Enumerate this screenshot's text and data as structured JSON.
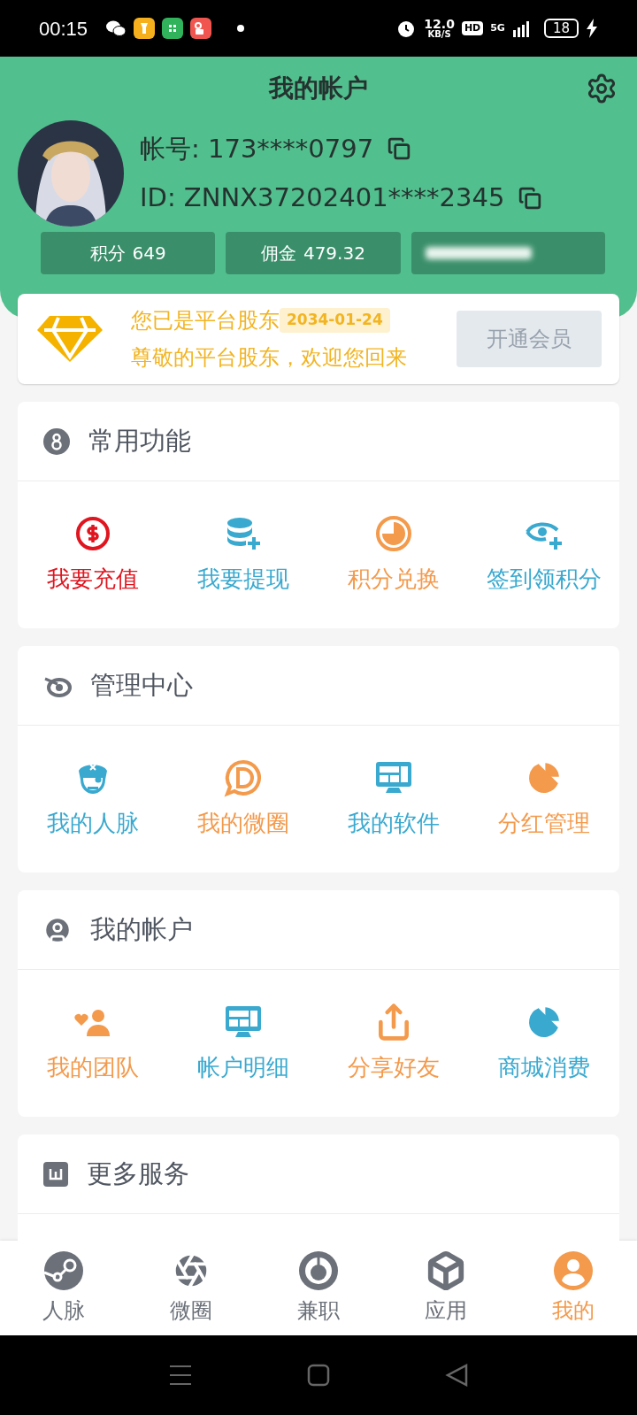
{
  "status_bar": {
    "time": "00:15",
    "speed": "12.0",
    "speed_unit": "KB/S",
    "hd": "HD",
    "network": "5G",
    "battery": "18"
  },
  "header": {
    "title": "我的帐户"
  },
  "profile": {
    "account": "帐号: 173****0797",
    "id": "ID: ZNNX37202401****2345"
  },
  "stats": [
    {
      "label": "积分",
      "value": "649"
    },
    {
      "label": "佣金",
      "value": "479.32"
    },
    {
      "kind": "obscured"
    }
  ],
  "membership": {
    "title": "您已是平台股东",
    "date": "2034-01-24",
    "subtitle": "尊敬的平台股东，欢迎您回来",
    "button": "开通会员",
    "disabled": true
  },
  "sections": [
    {
      "title": "常用功能",
      "kind": "badge",
      "items": [
        {
          "label": "我要充值",
          "kind": "dollar",
          "color": "#e0151f"
        },
        {
          "label": "我要提现",
          "kind": "database",
          "color": "#3aa9cf"
        },
        {
          "label": "积分兑换",
          "kind": "clock",
          "color": "#f39a4c"
        },
        {
          "label": "签到领积分",
          "kind": "eye",
          "color": "#3aa9cf"
        }
      ]
    },
    {
      "title": "管理中心",
      "kind": "orbit",
      "items": [
        {
          "label": "我的人脉",
          "kind": "pirate",
          "color": "#3aa9cf"
        },
        {
          "label": "我的微圈",
          "kind": "bubble",
          "color": "#f39a4c"
        },
        {
          "label": "我的软件",
          "kind": "monitor",
          "color": "#3aa9cf"
        },
        {
          "label": "分红管理",
          "kind": "pie",
          "color": "#f39a4c"
        }
      ]
    },
    {
      "title": "我的帐户",
      "kind": "user",
      "items": [
        {
          "label": "我的团队",
          "kind": "team",
          "color": "#f39a4c"
        },
        {
          "label": "帐户明细",
          "kind": "monitor",
          "color": "#3aa9cf"
        },
        {
          "label": "分享好友",
          "kind": "share",
          "color": "#f39a4c"
        },
        {
          "label": "商城消费",
          "kind": "pie",
          "color": "#3aa9cf"
        }
      ]
    },
    {
      "title": "更多服务",
      "kind": "square"
    }
  ],
  "tabs": [
    {
      "label": "人脉",
      "kind": "steam",
      "selected": false
    },
    {
      "label": "微圈",
      "kind": "aperture",
      "selected": false
    },
    {
      "label": "兼职",
      "kind": "gauge",
      "selected": false
    },
    {
      "label": "应用",
      "kind": "cube",
      "selected": false
    },
    {
      "label": "我的",
      "kind": "user",
      "selected": true
    }
  ]
}
